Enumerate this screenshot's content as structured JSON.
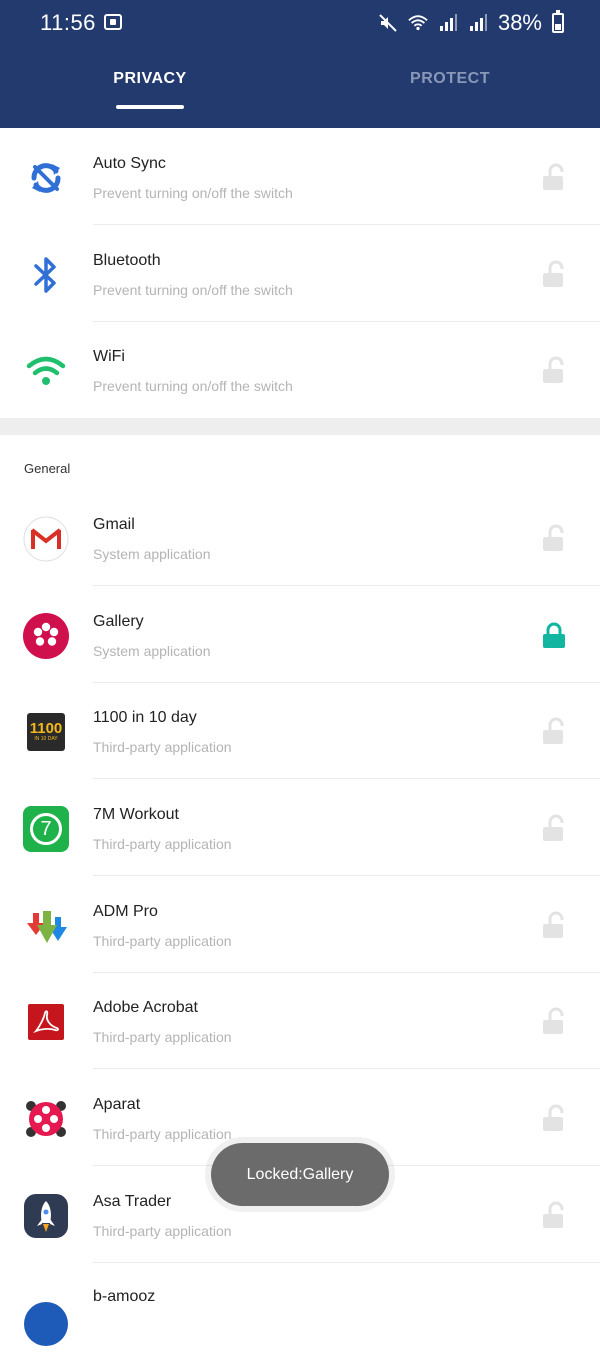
{
  "status": {
    "time": "11:56",
    "battery": "38%",
    "icons": [
      "sim-icon",
      "mute-icon",
      "wifi-calling-icon",
      "signal-icon",
      "signal-icon",
      "battery-icon"
    ]
  },
  "tabs": [
    {
      "label": "PRIVACY",
      "active": true
    },
    {
      "label": "PROTECT",
      "active": false
    }
  ],
  "switches": [
    {
      "title": "Auto Sync",
      "subtitle": "Prevent turning on/off the switch",
      "icon": "sync-icon",
      "locked": false
    },
    {
      "title": "Bluetooth",
      "subtitle": "Prevent turning on/off the switch",
      "icon": "bluetooth-icon",
      "locked": false
    },
    {
      "title": "WiFi",
      "subtitle": "Prevent turning on/off the switch",
      "icon": "wifi-icon",
      "locked": false
    }
  ],
  "general": {
    "label": "General",
    "apps": [
      {
        "title": "Gmail",
        "subtitle": "System application",
        "icon": "gmail-icon",
        "locked": false
      },
      {
        "title": "Gallery",
        "subtitle": "System application",
        "icon": "gallery-icon",
        "locked": true
      },
      {
        "title": "1100 in 10 day",
        "subtitle": "Third-party application",
        "icon": "app-1100-icon",
        "icon_text": "1100",
        "icon_subtext": "IN 10 DAY",
        "locked": false
      },
      {
        "title": "7M Workout",
        "subtitle": "Third-party application",
        "icon": "workout-icon",
        "icon_text": "7",
        "locked": false
      },
      {
        "title": "ADM Pro",
        "subtitle": "Third-party application",
        "icon": "download-arrows-icon",
        "locked": false
      },
      {
        "title": "Adobe Acrobat",
        "subtitle": "Third-party application",
        "icon": "acrobat-icon",
        "locked": false
      },
      {
        "title": "Aparat",
        "subtitle": "Third-party application",
        "icon": "aparat-icon",
        "locked": false
      },
      {
        "title": "Asa Trader",
        "subtitle": "Third-party application",
        "icon": "rocket-icon",
        "locked": false
      },
      {
        "title": "b-amooz",
        "subtitle": "",
        "icon": "b-amooz-icon",
        "locked": false
      }
    ]
  },
  "toast": {
    "text": "Locked:Gallery"
  },
  "colors": {
    "header": "#233a6e",
    "lock_active": "#12b5a0",
    "lock_inactive": "#e3e3e3",
    "sync_blue": "#2f6fd6",
    "wifi_green": "#1fbf6e"
  }
}
